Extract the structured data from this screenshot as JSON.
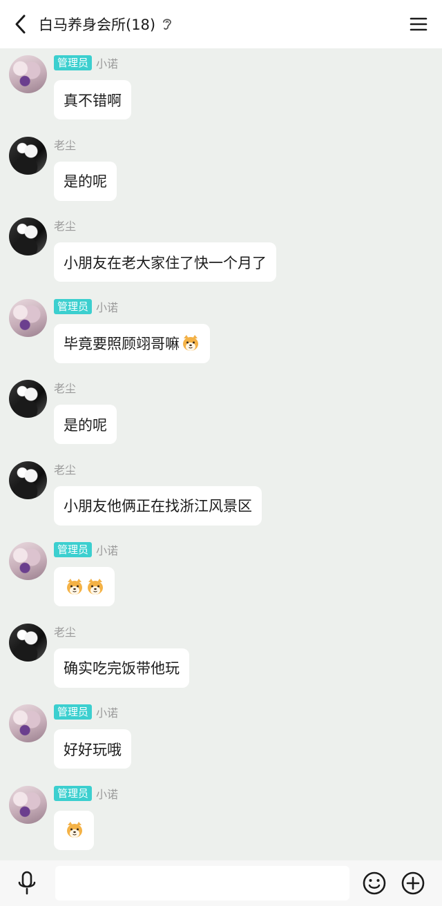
{
  "header": {
    "title": "白马养身会所(18)",
    "back_icon": "chevron-left-icon",
    "ear_icon": "ear-icon",
    "menu_icon": "hamburger-menu-icon"
  },
  "colors": {
    "admin_badge": "#3ccfcf",
    "chat_background": "#edf0ed",
    "bubble": "#ffffff"
  },
  "messages": [
    {
      "sender": "小诺",
      "badge": "管理员",
      "text": "真不错啊",
      "emoji_count": 0
    },
    {
      "sender": "老尘",
      "badge": "",
      "text": "是的呢",
      "emoji_count": 0
    },
    {
      "sender": "老尘",
      "badge": "",
      "text": "小朋友在老大家住了快一个月了",
      "emoji_count": 0
    },
    {
      "sender": "小诺",
      "badge": "管理员",
      "text": "毕竟要照顾翊哥嘛",
      "emoji_count": 1
    },
    {
      "sender": "老尘",
      "badge": "",
      "text": "是的呢",
      "emoji_count": 0
    },
    {
      "sender": "老尘",
      "badge": "",
      "text": "小朋友他俩正在找浙江风景区",
      "emoji_count": 0
    },
    {
      "sender": "小诺",
      "badge": "管理员",
      "text": "",
      "emoji_count": 2
    },
    {
      "sender": "老尘",
      "badge": "",
      "text": "确实吃完饭带他玩",
      "emoji_count": 0
    },
    {
      "sender": "小诺",
      "badge": "管理员",
      "text": "好好玩哦",
      "emoji_count": 0
    },
    {
      "sender": "小诺",
      "badge": "管理员",
      "text": "",
      "emoji_count": 1
    }
  ],
  "input_bar": {
    "placeholder": "",
    "mic_icon": "microphone-icon",
    "emoji_icon": "smiley-icon",
    "plus_icon": "plus-circle-icon"
  }
}
